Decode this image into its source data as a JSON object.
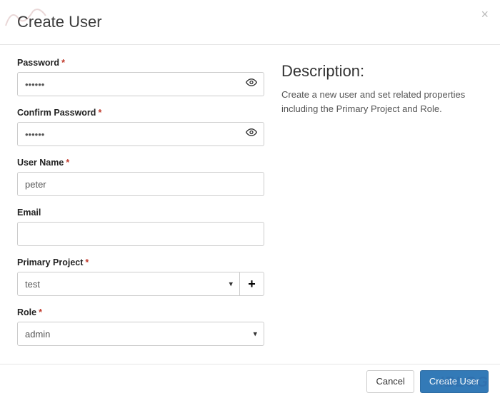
{
  "header": {
    "title": "Create User",
    "close": "×"
  },
  "form": {
    "password": {
      "label": "Password",
      "required": "*",
      "value": "••••••"
    },
    "confirm_password": {
      "label": "Confirm Password",
      "required": "*",
      "value": "••••••"
    },
    "user_name": {
      "label": "User Name",
      "required": "*",
      "value": "peter"
    },
    "email": {
      "label": "Email",
      "value": ""
    },
    "primary_project": {
      "label": "Primary Project",
      "required": "*",
      "value": "test",
      "add": "+"
    },
    "role": {
      "label": "Role",
      "required": "*",
      "value": "admin"
    }
  },
  "description": {
    "title": "Description:",
    "text": "Create a new user and set related properties including the Primary Project and Role."
  },
  "footer": {
    "cancel": "Cancel",
    "submit": "Create User"
  },
  "watermark": {
    "right": "IBLOG"
  }
}
